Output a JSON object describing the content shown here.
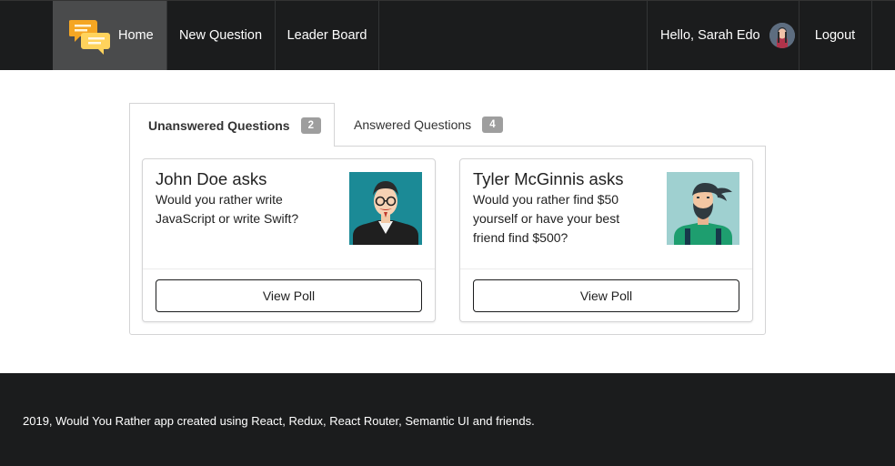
{
  "nav": {
    "home_label": "Home",
    "new_question_label": "New Question",
    "leader_board_label": "Leader Board",
    "greeting": "Hello, Sarah Edo",
    "logout_label": "Logout"
  },
  "tabs": [
    {
      "label": "Unanswered Questions",
      "count": "2"
    },
    {
      "label": "Answered Questions",
      "count": "4"
    }
  ],
  "questions": [
    {
      "author_line": "John Doe asks",
      "text": "Would you rather write JavaScript or write Swift?",
      "button_label": "View Poll"
    },
    {
      "author_line": "Tyler McGinnis asks",
      "text": "Would you rather find $50 yourself or have your best friend find $500?",
      "button_label": "View Poll"
    }
  ],
  "footer": {
    "text": "2019, Would You Rather app created using React, Redux, React Router, Semantic UI and friends."
  },
  "colors": {
    "navbar_bg": "#1b1c1d",
    "active_nav_bg": "#4a4b4c",
    "badge_bg": "#9e9e9e",
    "logo_yellow": "#f5b731"
  }
}
